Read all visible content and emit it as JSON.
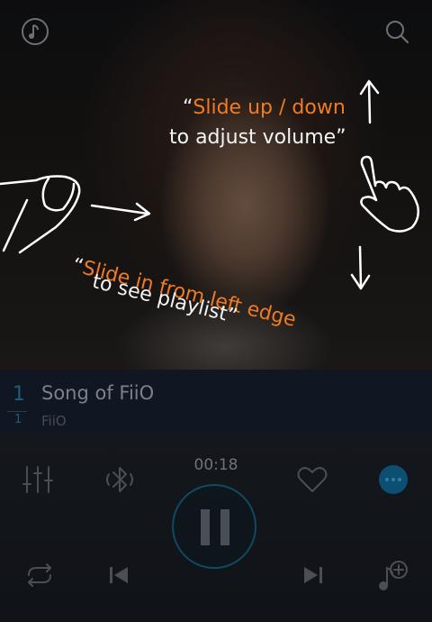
{
  "guide": {
    "volume_line1": "Slide up / down",
    "volume_line2": "to adjust volume",
    "playlist_line1": "Slide in from left edge",
    "playlist_line2": "to see playlist"
  },
  "track": {
    "number": "1",
    "sub_number": "1",
    "title": "Song of FiiO",
    "artist": "FiiO"
  },
  "player": {
    "elapsed": "00:18",
    "state": "playing",
    "accent_color": "#0c4f72"
  }
}
